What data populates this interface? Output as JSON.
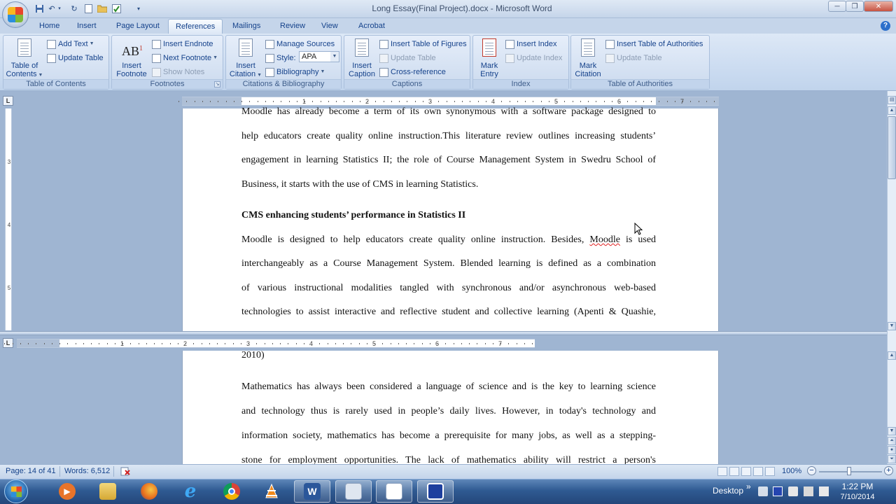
{
  "window": {
    "title": "Long Essay(Final Project).docx - Microsoft Word",
    "minimize": "─",
    "restore": "❐",
    "close": "✕"
  },
  "quick_access": {
    "save_icon": "save-icon",
    "undo_icon": "undo-icon",
    "redo_icon": "redo-icon",
    "new_icon": "new-document-icon",
    "open_icon": "open-folder-icon",
    "check_icon": "spelling-check-icon",
    "customize_icon": "customize-qat-icon"
  },
  "tabs": [
    "Home",
    "Insert",
    "Page Layout",
    "References",
    "Mailings",
    "Review",
    "View",
    "Acrobat"
  ],
  "active_tab": "References",
  "ribbon": {
    "toc": {
      "label": "Table of Contents",
      "btn_line1": "Table of",
      "btn_line2": "Contents",
      "add_text": "Add Text",
      "update_table": "Update Table"
    },
    "footnotes": {
      "label": "Footnotes",
      "insert_footnote_1": "Insert",
      "insert_footnote_2": "Footnote",
      "ab_glyph": "AB",
      "sup_glyph": "1",
      "insert_endnote": "Insert Endnote",
      "next_footnote": "Next Footnote",
      "show_notes": "Show Notes"
    },
    "citations": {
      "label": "Citations & Bibliography",
      "insert_citation_1": "Insert",
      "insert_citation_2": "Citation",
      "manage_sources": "Manage Sources",
      "style_label": "Style:",
      "style_value": "APA",
      "bibliography": "Bibliography"
    },
    "captions": {
      "label": "Captions",
      "insert_caption_1": "Insert",
      "insert_caption_2": "Caption",
      "insert_table_of_figures": "Insert Table of Figures",
      "update_table": "Update Table",
      "cross_reference": "Cross-reference"
    },
    "index": {
      "label": "Index",
      "mark_entry_1": "Mark",
      "mark_entry_2": "Entry",
      "insert_index": "Insert Index",
      "update_index": "Update Index"
    },
    "authorities": {
      "label": "Table of Authorities",
      "mark_citation_1": "Mark",
      "mark_citation_2": "Citation",
      "insert_toa": "Insert Table of Authorities",
      "update_table": "Update Table"
    }
  },
  "ruler": {
    "tab_selector": "L",
    "numbers": [
      "1",
      "2",
      "3",
      "4",
      "5",
      "6",
      "7"
    ],
    "v_numbers": [
      "3",
      "4",
      "5"
    ]
  },
  "document": {
    "pane1": [
      "Moodle has already become a term of its own synonymous with a software package designed to",
      "help educators create quality online instruction.This literature review outlines increasing students’",
      "engagement in learning Statistics II; the role of Course Management System in Swedru School of",
      "Business, it starts with the use of CMS in learning Statistics."
    ],
    "heading": "CMS enhancing students’ performance in Statistics  II",
    "pane1_para2": {
      "line1_before": "Moodle is designed to help educators create quality online instruction. Besides,",
      "line1_misspelled": "Moodle",
      "line1_after": "is used",
      "line2": "interchangeably as a Course Management System. Blended learning is defined as a combination",
      "line3": "of various instructional modalities tangled with synchronous and/or asynchronous web-based",
      "line4": "technologies to assist interactive and reflective student and collective learning (Apenti & Quashie,"
    },
    "pane2": [
      "2010)",
      "Mathematics has always been considered a language of science and is the key to learning science",
      "and technology thus is rarely used in people’s daily lives. However, in today's technology and",
      "information society, mathematics has become a prerequisite for many jobs, as well as a stepping-",
      "stone for employment opportunities. The lack of mathematics ability will restrict a person's"
    ]
  },
  "status": {
    "page": "Page: 14 of 41",
    "words": "Words: 6,512",
    "proofing_icon": "proofing-errors-icon",
    "zoom": "100%",
    "zoom_out": "−",
    "zoom_in": "+",
    "zoom_level": 1.0
  },
  "taskbar": {
    "apps": [
      "media-player-icon",
      "file-explorer-icon",
      "firefox-icon",
      "internet-explorer-icon",
      "chrome-icon",
      "vlc-icon",
      "word-icon",
      "pen-app-icon",
      "reader-app-icon",
      "remote-app-icon"
    ],
    "desktop_label": "Desktop",
    "chevron": "»",
    "time": "1:22 PM",
    "date": "7/10/2014"
  },
  "colors": {
    "ribbon_text": "#15428b",
    "word_blue": "#2b579a",
    "spell_error": "#e02020"
  }
}
